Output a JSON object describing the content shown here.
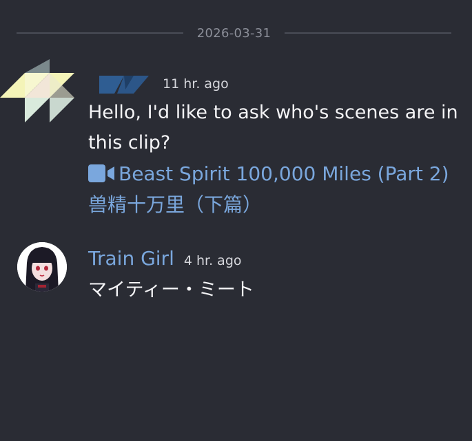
{
  "chat": {
    "date_divider": "2026-03-31",
    "messages": [
      {
        "username": "",
        "timestamp": "11 hr. ago",
        "text": "Hello, I'd like to ask who's scenes are in this clip?",
        "link": {
          "icon": "video-camera-icon",
          "label": "Beast Spirit 100,000 Miles (Part 2)兽精十万里（下篇）"
        }
      },
      {
        "username": "Train Girl",
        "timestamp": "4 hr. ago",
        "text": "マイティー・ミート"
      }
    ]
  },
  "colors": {
    "background": "#2a2c34",
    "accent": "#7aa7dd",
    "divider": "#4a4d57",
    "muted_text": "#8c8f99"
  }
}
